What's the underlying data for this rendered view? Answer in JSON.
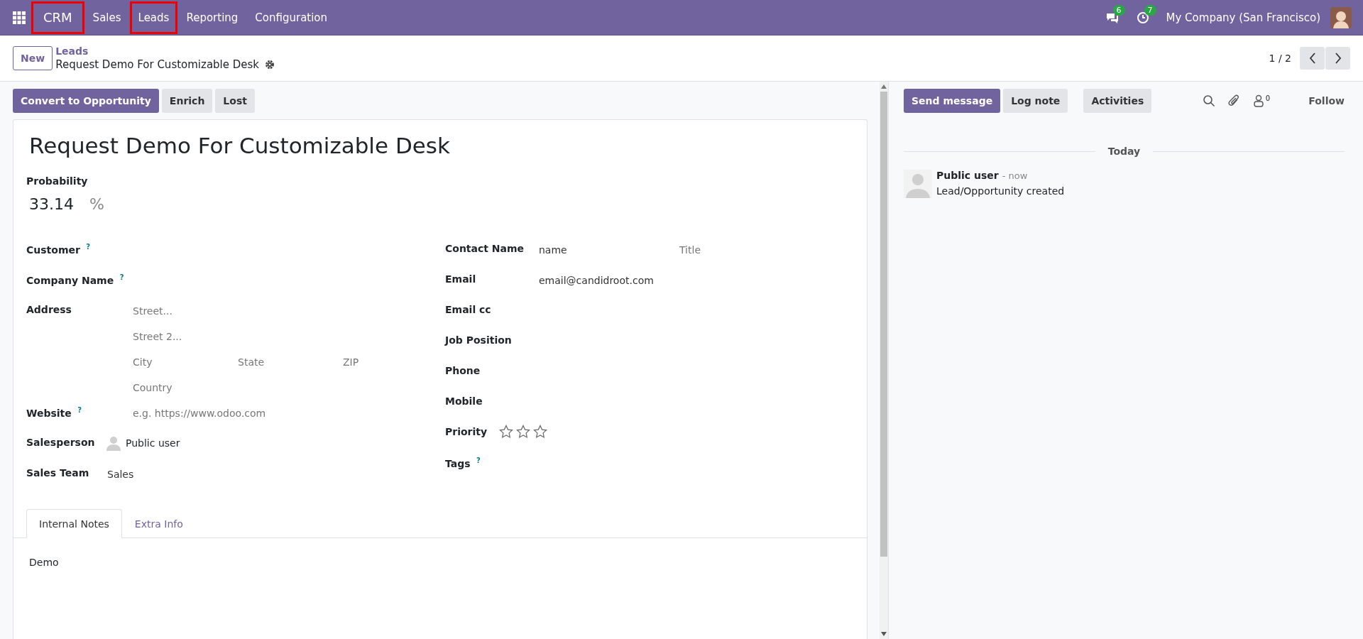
{
  "navbar": {
    "app": {
      "label": "CRM",
      "highlighted": true
    },
    "menu": [
      {
        "label": "Sales",
        "highlighted": false
      },
      {
        "label": "Leads",
        "highlighted": true
      },
      {
        "label": "Reporting",
        "highlighted": false
      },
      {
        "label": "Configuration",
        "highlighted": false
      }
    ],
    "messages_count": "6",
    "activities_count": "7",
    "company": "My Company (San Francisco)"
  },
  "control_panel": {
    "new_button": "New",
    "breadcrumb": "Leads",
    "record_name": "Request Demo For Customizable Desk",
    "pager": "1 / 2"
  },
  "status_buttons": [
    {
      "label": "Convert to Opportunity",
      "primary": true
    },
    {
      "label": "Enrich",
      "primary": false
    },
    {
      "label": "Lost",
      "primary": false
    }
  ],
  "form": {
    "title": "Request Demo For Customizable Desk",
    "probability_label": "Probability",
    "probability": "33.14",
    "percent": "%",
    "left_fields": [
      {
        "label": "Customer",
        "help": "?",
        "kind": "input"
      },
      {
        "label": "Company Name",
        "help": "?",
        "kind": "input"
      },
      {
        "label": "Address",
        "kind": "input",
        "inputs": [
          [
            {
              "placeholder": "Street..."
            }
          ],
          [
            {
              "placeholder": "Street 2..."
            }
          ],
          [
            {
              "placeholder": "City"
            },
            {
              "placeholder": "State"
            },
            {
              "placeholder": "ZIP"
            }
          ],
          [
            {
              "placeholder": "Country"
            }
          ]
        ]
      },
      {
        "label": "Website",
        "help": "?",
        "kind": "input",
        "inputs": [
          [
            {
              "placeholder": "e.g. https://www.odoo.com"
            }
          ]
        ]
      },
      {
        "label": "Salesperson",
        "kind": "user",
        "value": "Public user"
      },
      {
        "label": "Sales Team",
        "kind": "input",
        "inputs": [
          [
            {
              "value": "Sales"
            }
          ]
        ]
      }
    ],
    "right_fields": [
      {
        "label": "Contact Name",
        "kind": "input",
        "inputs": [
          [
            {
              "value": "name"
            },
            {
              "placeholder": "Title"
            }
          ]
        ]
      },
      {
        "label": "Email",
        "kind": "input",
        "inputs": [
          [
            {
              "value": "email@candidroot.com"
            }
          ]
        ]
      },
      {
        "label": "Email cc",
        "kind": "input"
      },
      {
        "label": "Job Position",
        "kind": "input"
      },
      {
        "label": "Phone",
        "kind": "input"
      },
      {
        "label": "Mobile",
        "kind": "input"
      },
      {
        "label": "Priority",
        "kind": "priority",
        "stars": 0
      },
      {
        "label": "Tags",
        "help": "?",
        "kind": "input"
      }
    ],
    "tabs": [
      {
        "label": "Internal Notes",
        "selected": true
      },
      {
        "label": "Extra Info",
        "selected": false
      }
    ],
    "notes": "Demo"
  },
  "chatter": {
    "buttons": [
      {
        "label": "Send message",
        "primary": true
      },
      {
        "label": "Log note",
        "primary": false
      },
      {
        "label": "Activities",
        "primary": false
      }
    ],
    "followers_count": "0",
    "follow": "Follow",
    "date": "Today",
    "messages": [
      {
        "author": "Public user",
        "time": "- now",
        "body": "Lead/Opportunity created"
      }
    ]
  }
}
